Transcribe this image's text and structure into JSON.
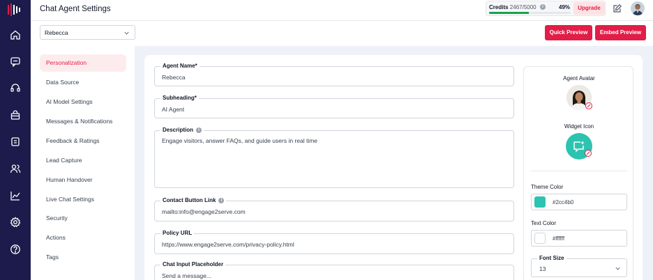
{
  "header": {
    "title": "Chat Agent Settings",
    "credits_label": "Credits",
    "credits_value": "2467/5000",
    "credits_percent": "49%",
    "credits_fraction": 0.49,
    "upgrade_label": "Upgrade"
  },
  "toolbar": {
    "agent_selected": "Rebecca",
    "quick_preview_label": "Quick Preview",
    "embed_preview_label": "Embed Preview"
  },
  "menu": {
    "items": [
      {
        "label": "Personalization",
        "active": true
      },
      {
        "label": "Data Source"
      },
      {
        "label": "AI Model Settings"
      },
      {
        "label": "Messages & Notifications"
      },
      {
        "label": "Feedback & Ratings"
      },
      {
        "label": "Lead Capture"
      },
      {
        "label": "Human Handover"
      },
      {
        "label": "Live Chat Settings"
      },
      {
        "label": "Security"
      },
      {
        "label": "Actions"
      },
      {
        "label": "Tags"
      }
    ]
  },
  "form": {
    "agent_name": {
      "label": "Agent Name*",
      "value": "Rebecca"
    },
    "subheading": {
      "label": "Subheading*",
      "value": "AI Agent"
    },
    "description": {
      "label": "Description",
      "value": "Engage visitors, answer FAQs, and guide users in real time"
    },
    "contact_link": {
      "label": "Contact Button Link",
      "value": "mailto:info@engage2serve.com"
    },
    "policy_url": {
      "label": "Policy URL",
      "value": "https://www.engage2serve.com/privacy-policy.html"
    },
    "chat_placeholder": {
      "label": "Chat Input Placeholder",
      "value": "Send a message..."
    }
  },
  "side": {
    "agent_avatar_label": "Agent Avatar",
    "widget_icon_label": "Widget Icon",
    "theme_color_label": "Theme Color",
    "theme_color": "#2cc4b0",
    "text_color_label": "Text Color",
    "text_color": "#ffffff",
    "font_size_label": "Font Size",
    "font_size": "13"
  },
  "icons": {
    "rail": [
      "home-icon",
      "chat-icon",
      "headset-icon",
      "bag-icon",
      "clipboard-icon",
      "users-icon",
      "analytics-icon",
      "settings-icon",
      "help-icon"
    ],
    "header": [
      "edit-note-icon",
      "user-avatar"
    ]
  },
  "colors": {
    "rail": "#1d1b4b",
    "accent": "#e11d48",
    "theme": "#2cc4b0"
  }
}
